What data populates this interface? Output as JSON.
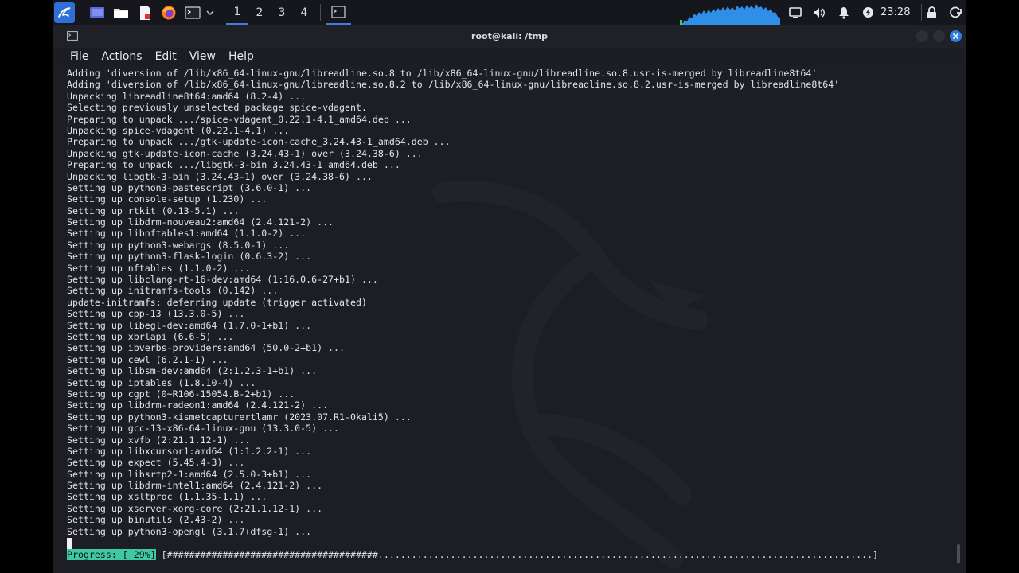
{
  "panel": {
    "workspaces": [
      "1",
      "2",
      "3",
      "4"
    ],
    "active_workspace": "1",
    "clock": "23:28"
  },
  "window": {
    "title": "root@kali: /tmp"
  },
  "menu": [
    "File",
    "Actions",
    "Edit",
    "View",
    "Help"
  ],
  "terminal": {
    "lines": [
      "Adding 'diversion of /lib/x86_64-linux-gnu/libreadline.so.8 to /lib/x86_64-linux-gnu/libreadline.so.8.usr-is-merged by libreadline8t64'",
      "Adding 'diversion of /lib/x86_64-linux-gnu/libreadline.so.8.2 to /lib/x86_64-linux-gnu/libreadline.so.8.2.usr-is-merged by libreadline8t64'",
      "Unpacking libreadline8t64:amd64 (8.2-4) ...",
      "Selecting previously unselected package spice-vdagent.",
      "Preparing to unpack .../spice-vdagent_0.22.1-4.1_amd64.deb ...",
      "Unpacking spice-vdagent (0.22.1-4.1) ...",
      "Preparing to unpack .../gtk-update-icon-cache_3.24.43-1_amd64.deb ...",
      "Unpacking gtk-update-icon-cache (3.24.43-1) over (3.24.38-6) ...",
      "Preparing to unpack .../libgtk-3-bin_3.24.43-1_amd64.deb ...",
      "Unpacking libgtk-3-bin (3.24.43-1) over (3.24.38-6) ...",
      "Setting up python3-pastescript (3.6.0-1) ...",
      "Setting up console-setup (1.230) ...",
      "Setting up rtkit (0.13-5.1) ...",
      "Setting up libdrm-nouveau2:amd64 (2.4.121-2) ...",
      "Setting up libnftables1:amd64 (1.1.0-2) ...",
      "Setting up python3-webargs (8.5.0-1) ...",
      "Setting up python3-flask-login (0.6.3-2) ...",
      "Setting up nftables (1.1.0-2) ...",
      "Setting up libclang-rt-16-dev:amd64 (1:16.0.6-27+b1) ...",
      "Setting up initramfs-tools (0.142) ...",
      "update-initramfs: deferring update (trigger activated)",
      "Setting up cpp-13 (13.3.0-5) ...",
      "Setting up libegl-dev:amd64 (1.7.0-1+b1) ...",
      "Setting up xbrlapi (6.6-5) ...",
      "Setting up ibverbs-providers:amd64 (50.0-2+b1) ...",
      "Setting up cewl (6.2.1-1) ...",
      "Setting up libsm-dev:amd64 (2:1.2.3-1+b1) ...",
      "Setting up iptables (1.8.10-4) ...",
      "Setting up cgpt (0~R106-15054.B-2+b1) ...",
      "Setting up libdrm-radeon1:amd64 (2.4.121-2) ...",
      "Setting up python3-kismetcapturertlamr (2023.07.R1-0kali5) ...",
      "Setting up gcc-13-x86-64-linux-gnu (13.3.0-5) ...",
      "Setting up xvfb (2:21.1.12-1) ...",
      "Setting up libxcursor1:amd64 (1:1.2.2-1) ...",
      "Setting up expect (5.45.4-3) ...",
      "Setting up libsrtp2-1:amd64 (2.5.0-3+b1) ...",
      "Setting up libdrm-intel1:amd64 (2.4.121-2) ...",
      "Setting up xsltproc (1.1.35-1.1) ...",
      "Setting up xserver-xorg-core (2:21.1.12-1) ...",
      "Setting up binutils (2.43-2) ...",
      "Setting up python3-opengl (3.1.7+dfsg-1) ..."
    ],
    "progress_label": "Progress: [ 29%]",
    "progress_bar": " [######################################.........................................................................................]",
    "progress_percent": 29
  },
  "colors": {
    "accent": "#3d7ee6",
    "progress_label_bg": "#3fc9a0",
    "terminal_bg": "#1c1e24",
    "close_button": "#2f7de1"
  },
  "icons": {
    "kali_menu": "kali-dragon-icon",
    "show_desktop": "desktop-icon",
    "file_manager": "folder-icon",
    "text_editor": "text-editor-icon",
    "browser": "firefox-icon",
    "terminal": "terminal-icon",
    "tray": [
      "display-icon",
      "volume-icon",
      "bell-icon",
      "power-manager-icon",
      "lock-icon",
      "logout-icon"
    ]
  }
}
